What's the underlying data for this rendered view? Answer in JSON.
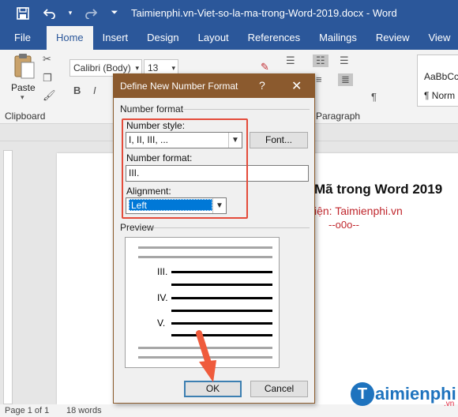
{
  "titlebar": {
    "title": "Taimienphi.vn-Viet-so-la-ma-trong-Word-2019.docx  -  Word",
    "save_icon": "save-icon",
    "undo_icon": "undo-icon",
    "redo_icon": "redo-icon",
    "customize_icon": "customize-qat-icon"
  },
  "tabs": [
    "File",
    "Home",
    "Insert",
    "Design",
    "Layout",
    "References",
    "Mailings",
    "Review",
    "View"
  ],
  "ribbon": {
    "paste_label": "Paste",
    "clipboard_label": "Clipboard",
    "font_name": "Calibri (Body)",
    "font_size": "13",
    "paragraph_label": "Paragraph",
    "bold": "B",
    "italic": "I",
    "style_preview": "AaBbCcI",
    "style_name": "¶ Norm"
  },
  "document": {
    "line1": "Mã trong Word 2019",
    "line2": "iện: Taimienphi.vn",
    "line3": "--o0o--"
  },
  "dialog": {
    "title": "Define New Number Format",
    "help": "?",
    "close": "✕",
    "section_number_format": "Number format",
    "number_style_label": "Number style:",
    "number_style_value": "I, II, III, ...",
    "font_button": "Font...",
    "number_format_label": "Number format:",
    "number_format_value": "III.",
    "alignment_label": "Alignment:",
    "alignment_value": "Left",
    "preview_label": "Preview",
    "preview_numbers": [
      "III.",
      "IV.",
      "V."
    ],
    "ok_button": "OK",
    "cancel_button": "Cancel"
  },
  "status": {
    "page": "Page 1 of 1",
    "words": "18 words"
  },
  "watermark": {
    "logo_letter": "T",
    "logo_text": "aimienphi",
    "logo_suffix": ".vn"
  },
  "colors": {
    "word_blue": "#2b579a",
    "dialog_title": "#8b5a2e",
    "highlight_red": "#e44b3a",
    "selection_blue": "#0078d7"
  }
}
